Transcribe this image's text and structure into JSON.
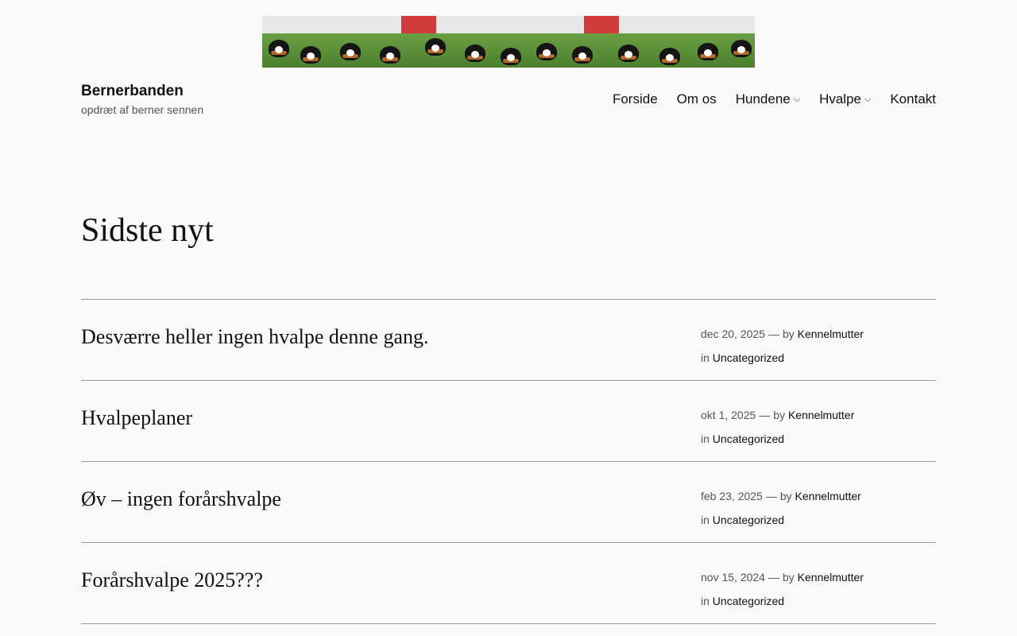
{
  "site": {
    "title": "Bernerbanden",
    "tagline": "opdræt af berner sennen"
  },
  "nav": [
    {
      "label": "Forside",
      "has_children": false
    },
    {
      "label": "Om os",
      "has_children": false
    },
    {
      "label": "Hundene",
      "has_children": true
    },
    {
      "label": "Hvalpe",
      "has_children": true
    },
    {
      "label": "Kontakt",
      "has_children": false
    }
  ],
  "icons": {
    "chevron": "chevron-down-icon",
    "chevron_glyph": "⌵"
  },
  "page": {
    "title": "Sidste nyt"
  },
  "meta_words": {
    "by": "by",
    "in": "in",
    "dash": "—"
  },
  "posts": [
    {
      "title": "Desværre heller ingen hvalpe denne gang.",
      "date": "dec 20, 2025",
      "author": "Kennelmutter",
      "category": "Uncategorized"
    },
    {
      "title": "Hvalpeplaner",
      "date": "okt 1, 2025",
      "author": "Kennelmutter",
      "category": "Uncategorized"
    },
    {
      "title": "Øv – ingen forårshvalpe",
      "date": "feb 23, 2025",
      "author": "Kennelmutter",
      "category": "Uncategorized"
    },
    {
      "title": "Forårshvalpe 2025???",
      "date": "nov 15, 2024",
      "author": "Kennelmutter",
      "category": "Uncategorized"
    }
  ]
}
